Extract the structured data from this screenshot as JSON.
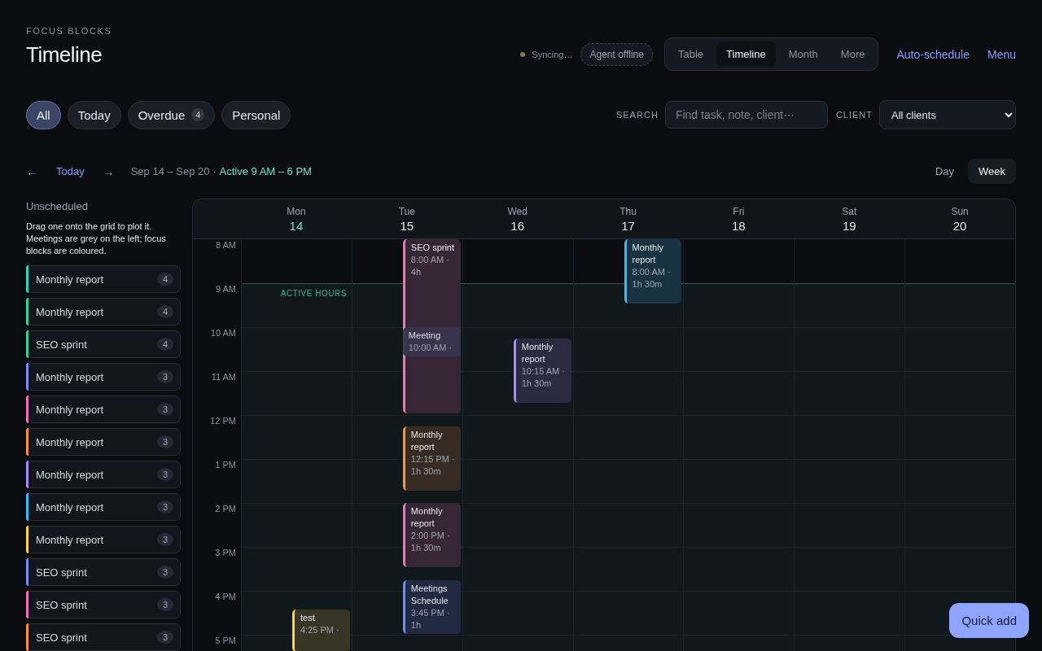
{
  "header": {
    "eyebrow": "FOCUS BLOCKS",
    "title": "Timeline"
  },
  "status": {
    "label": "Syncing…",
    "color": "#8a7a4a"
  },
  "agent": "Agent offline",
  "views": [
    {
      "label": "Table",
      "selected": false
    },
    {
      "label": "Timeline",
      "selected": true
    },
    {
      "label": "Month",
      "selected": false
    },
    {
      "label": "More",
      "selected": false
    }
  ],
  "links": [
    "Auto-schedule",
    "Menu"
  ],
  "filters": [
    {
      "label": "All",
      "selected": true
    },
    {
      "label": "Today",
      "selected": false
    },
    {
      "label": "Overdue",
      "count": "4",
      "selected": false
    },
    {
      "label": "Personal",
      "selected": false
    }
  ],
  "search": {
    "label": "SEARCH",
    "placeholder": "Find task, note, client⋯"
  },
  "client": {
    "label": "CLIENT",
    "value": "All clients"
  },
  "nav": {
    "prev": "←",
    "today": "Today",
    "next": "→",
    "range": "Sep 14 – Sep 20 ·",
    "active": "Active 9 AM – 6 PM"
  },
  "modes": [
    {
      "label": "Day",
      "selected": false
    },
    {
      "label": "Week",
      "selected": true
    }
  ],
  "unscheduled": {
    "title": "Unscheduled",
    "hint": "Drag one onto the grid to plot it. Meetings are grey on the left; focus blocks are coloured.",
    "items": [
      {
        "title": "Monthly report",
        "count": "4",
        "color": "#2dd4bf"
      },
      {
        "title": "Monthly report",
        "count": "4",
        "color": "#34d399"
      },
      {
        "title": "SEO sprint",
        "count": "4",
        "color": "#34d399"
      },
      {
        "title": "Monthly report",
        "count": "3",
        "color": "#818cf8"
      },
      {
        "title": "Monthly report",
        "count": "3",
        "color": "#f472b6"
      },
      {
        "title": "Monthly report",
        "count": "3",
        "color": "#fb923c"
      },
      {
        "title": "Monthly report",
        "count": "3",
        "color": "#a78bfa"
      },
      {
        "title": "Monthly report",
        "count": "3",
        "color": "#38bdf8"
      },
      {
        "title": "Monthly report",
        "count": "3",
        "color": "#fcd34d"
      },
      {
        "title": "SEO sprint",
        "count": "3",
        "color": "#818cf8"
      },
      {
        "title": "SEO sprint",
        "count": "3",
        "color": "#f472b6"
      },
      {
        "title": "SEO sprint",
        "count": "3",
        "color": "#fb923c"
      }
    ]
  },
  "calendar": {
    "active_label": "ACTIVE HOURS",
    "hours": [
      {
        "label": "8 AM",
        "active": false
      },
      {
        "label": "9 AM",
        "active": true
      },
      {
        "label": "10 AM",
        "active": true
      },
      {
        "label": "11 AM",
        "active": true
      },
      {
        "label": "12 PM",
        "active": true
      },
      {
        "label": "1 PM",
        "active": true
      },
      {
        "label": "2 PM",
        "active": true
      },
      {
        "label": "3 PM",
        "active": true
      },
      {
        "label": "4 PM",
        "active": true
      },
      {
        "label": "5 PM",
        "active": true
      }
    ],
    "days": [
      {
        "name": "Mon",
        "date": "14",
        "today": true,
        "events": [
          {
            "kind": "focus",
            "title": "test",
            "when": "4:25 PM ·",
            "color": "#fcd34d"
          }
        ]
      },
      {
        "name": "Tue",
        "date": "15",
        "today": false,
        "events": [
          {
            "kind": "focus",
            "title": "SEO sprint",
            "when": "8:00 AM · 4h",
            "color": "#f472b6"
          },
          {
            "kind": "meeting",
            "title": "Meeting",
            "when": "10:00 AM ·"
          },
          {
            "kind": "focus",
            "title": "Monthly report",
            "when": "12:15 PM · 1h 30m",
            "color": "#fb923c"
          },
          {
            "kind": "focus",
            "title": "Monthly report",
            "when": "2:00 PM · 1h 30m",
            "color": "#f472b6"
          },
          {
            "kind": "focus",
            "title": "Meetings Schedule",
            "when": "3:45 PM · 1h",
            "color": "#6b8cff"
          }
        ]
      },
      {
        "name": "Wed",
        "date": "16",
        "today": false,
        "events": [
          {
            "kind": "focus",
            "title": "Monthly report",
            "when": "10:15 AM · 1h 30m",
            "color": "#a78bfa"
          }
        ]
      },
      {
        "name": "Thu",
        "date": "17",
        "today": false,
        "events": [
          {
            "kind": "focus",
            "title": "Monthly report",
            "when": "8:00 AM · 1h 30m",
            "color": "#38bdf8"
          }
        ]
      },
      {
        "name": "Fri",
        "date": "18",
        "today": false
      },
      {
        "name": "Sat",
        "date": "19",
        "today": false
      },
      {
        "name": "Sun",
        "date": "20",
        "today": false
      }
    ]
  },
  "quick_add": "Quick add"
}
